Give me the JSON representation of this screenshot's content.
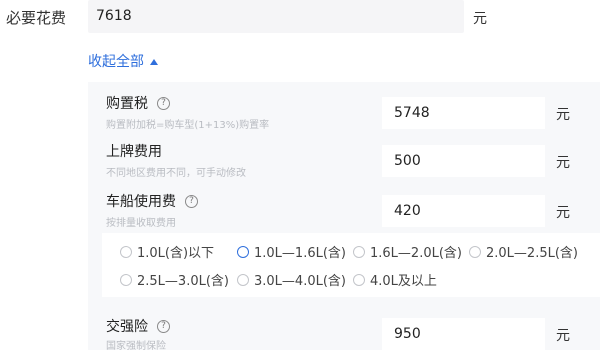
{
  "required_cost": {
    "label": "必要花费",
    "value": "7618",
    "unit": "元"
  },
  "collapse": {
    "label": "收起全部"
  },
  "items": [
    {
      "title": "购置税",
      "subtitle": "购置附加税=购车型(1+13%)购置率",
      "value": "5748",
      "unit": "元",
      "has_help": true
    },
    {
      "title": "上牌费用",
      "subtitle": "不同地区费用不同，可手动修改",
      "value": "500",
      "unit": "元",
      "has_help": false
    },
    {
      "title": "车船使用费",
      "subtitle": "按排量收取费用",
      "value": "420",
      "unit": "元",
      "has_help": true
    },
    {
      "title": "交强险",
      "subtitle": "国家强制保险",
      "value": "950",
      "unit": "元",
      "has_help": true
    }
  ],
  "help_icon": {
    "glyph": "?"
  },
  "displacement_options": {
    "selected": "1.0L—1.6L(含)",
    "options": [
      "1.0L(含)以下",
      "1.0L—1.6L(含)",
      "1.6L—2.0L(含)",
      "2.0L—2.5L(含)",
      "2.5L—3.0L(含)",
      "3.0L—4.0L(含)",
      "4.0L及以上"
    ]
  },
  "colors": {
    "accent": "#2f6fdc",
    "panel_bg": "#f7f8fa",
    "field_bg": "#f5f5f7"
  }
}
